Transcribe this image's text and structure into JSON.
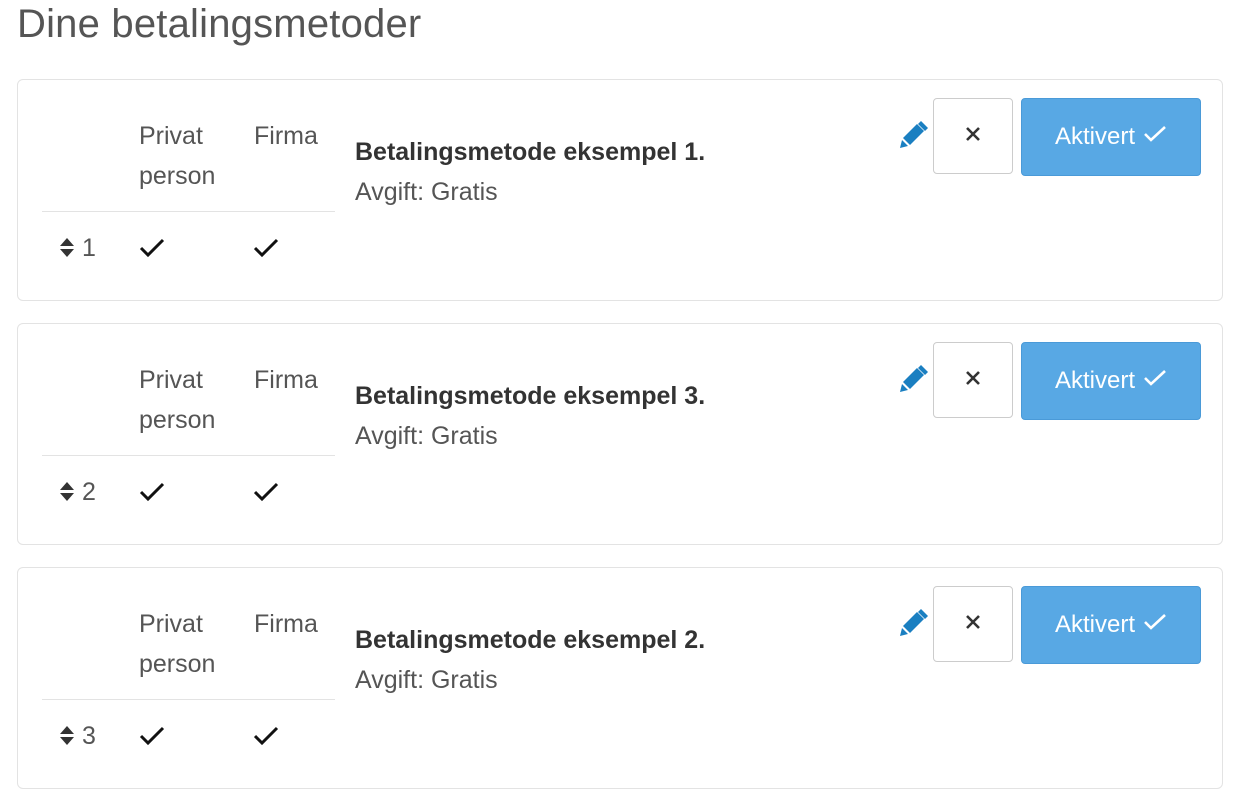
{
  "page": {
    "title": "Dine betalingsmetoder"
  },
  "columns": {
    "privat_line1": "Privat",
    "privat_line2": "person",
    "firma": "Firma"
  },
  "colors": {
    "accent": "#58a8e4",
    "edit_icon": "#1a7fc1",
    "card_border": "#e3e3e3"
  },
  "icons": {
    "sort": "sort-icon",
    "check": "checkmark-icon",
    "edit": "pencil-icon",
    "close": "close-icon"
  },
  "methods": [
    {
      "order": "1",
      "name": "Betalingsmetode eksempel 1.",
      "fee": "Avgift: Gratis",
      "privat_enabled": true,
      "firma_enabled": true,
      "activate_label": "Aktivert"
    },
    {
      "order": "2",
      "name": "Betalingsmetode eksempel 3.",
      "fee": "Avgift: Gratis",
      "privat_enabled": true,
      "firma_enabled": true,
      "activate_label": "Aktivert"
    },
    {
      "order": "3",
      "name": "Betalingsmetode eksempel 2.",
      "fee": "Avgift: Gratis",
      "privat_enabled": true,
      "firma_enabled": true,
      "activate_label": "Aktivert"
    }
  ]
}
